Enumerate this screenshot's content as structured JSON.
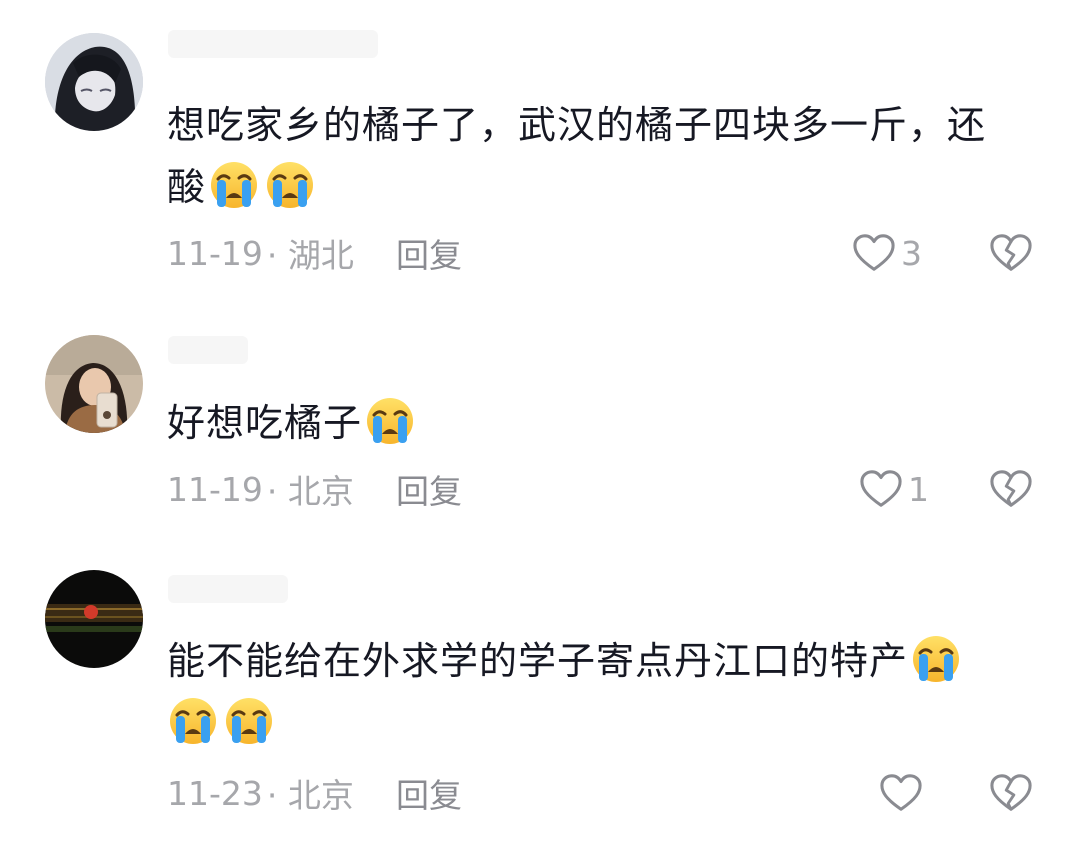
{
  "comments": [
    {
      "text_parts": [
        "想吃家乡的橘子了，武汉的橘子四块多一斤，还",
        "酸"
      ],
      "emojis": [
        "crying-face-emoji",
        "crying-face-emoji"
      ],
      "date": "11-19",
      "location": "· 湖北",
      "reply_label": "回复",
      "like_count": "3"
    },
    {
      "text_parts": [
        "好想吃橘子"
      ],
      "emojis": [
        "crying-face-emoji"
      ],
      "date": "11-19",
      "location": "· 北京",
      "reply_label": "回复",
      "like_count": "1"
    },
    {
      "text_parts": [
        "能不能给在外求学的学子寄点丹江口的特产"
      ],
      "emojis": [
        "crying-face-emoji",
        "crying-face-emoji",
        "crying-face-emoji"
      ],
      "date": "11-23",
      "location": "· 北京",
      "reply_label": "回复",
      "like_count": ""
    }
  ],
  "icons": {
    "like": "heart-outline-icon",
    "dislike": "broken-heart-icon"
  },
  "colors": {
    "text": "#161823",
    "meta": "#a6a7ab",
    "icon": "#8a8b91",
    "emoji_face": "#ffcc33",
    "emoji_tear": "#3aa0f0"
  }
}
